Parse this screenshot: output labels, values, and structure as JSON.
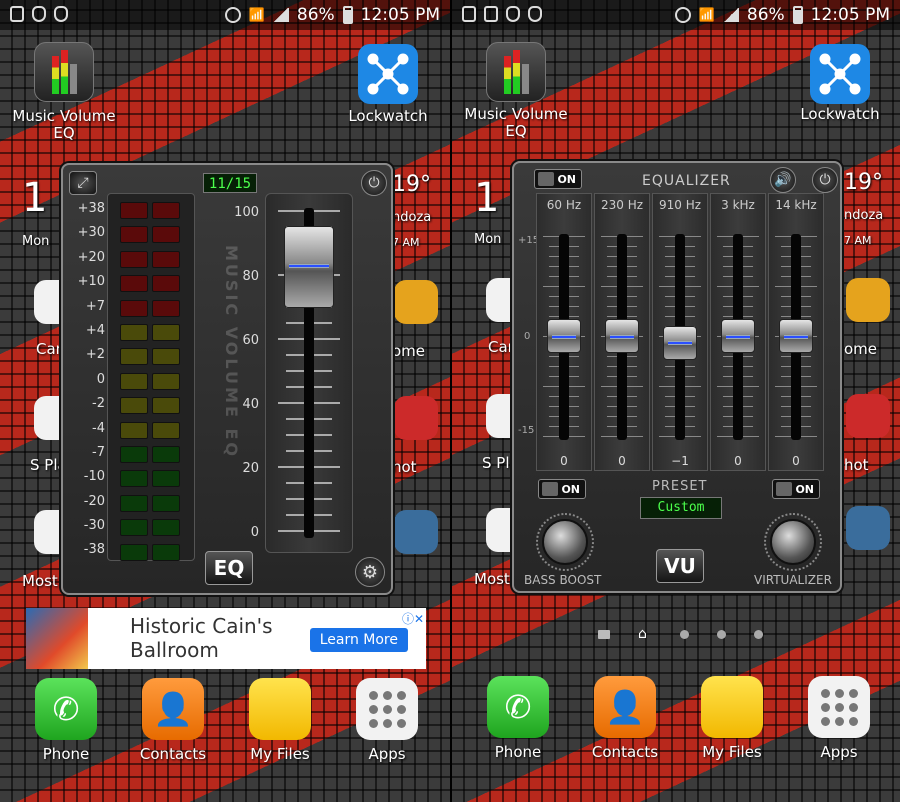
{
  "status": {
    "battery": "86%",
    "time": "12:05 PM"
  },
  "home": {
    "top_apps": [
      "Music Volume EQ",
      "Lockwatch"
    ],
    "dock": [
      "Phone",
      "Contacts",
      "My Files",
      "Apps"
    ],
    "partial_labels_left": [
      "Mon",
      "Cam",
      "S Pla",
      "Most"
    ],
    "partial_labels_right": [
      "19°",
      "ndoza",
      "7 AM",
      "ome",
      "hot"
    ],
    "partial_clock": "1"
  },
  "volume_widget": {
    "counter": "11/15",
    "db_levels": [
      "+38",
      "+30",
      "+20",
      "+10",
      "+7",
      "+4",
      "+2",
      "0",
      "-2",
      "-4",
      "-7",
      "-10",
      "-20",
      "-30",
      "-38"
    ],
    "scale": [
      "100",
      "80",
      "60",
      "40",
      "20",
      "0"
    ],
    "vertical_text": "MUSIC VOLUME EQ",
    "mode_button": "EQ",
    "volume_level_pct": 82
  },
  "ad": {
    "headline": "Historic Cain's Ballroom",
    "cta": "Learn More"
  },
  "equalizer": {
    "title": "EQUALIZER",
    "toggle_label": "ON",
    "bands": [
      {
        "freq": "60 Hz",
        "value": "0"
      },
      {
        "freq": "230 Hz",
        "value": "0"
      },
      {
        "freq": "910 Hz",
        "value": "−1"
      },
      {
        "freq": "3 kHz",
        "value": "0"
      },
      {
        "freq": "14 kHz",
        "value": "0"
      }
    ],
    "db_labels": [
      "+15",
      "0",
      "-15"
    ],
    "preset_title": "PRESET",
    "preset_value": "Custom",
    "bass_label": "BASS BOOST",
    "virt_label": "VIRTUALIZER",
    "mode_button": "VU"
  }
}
